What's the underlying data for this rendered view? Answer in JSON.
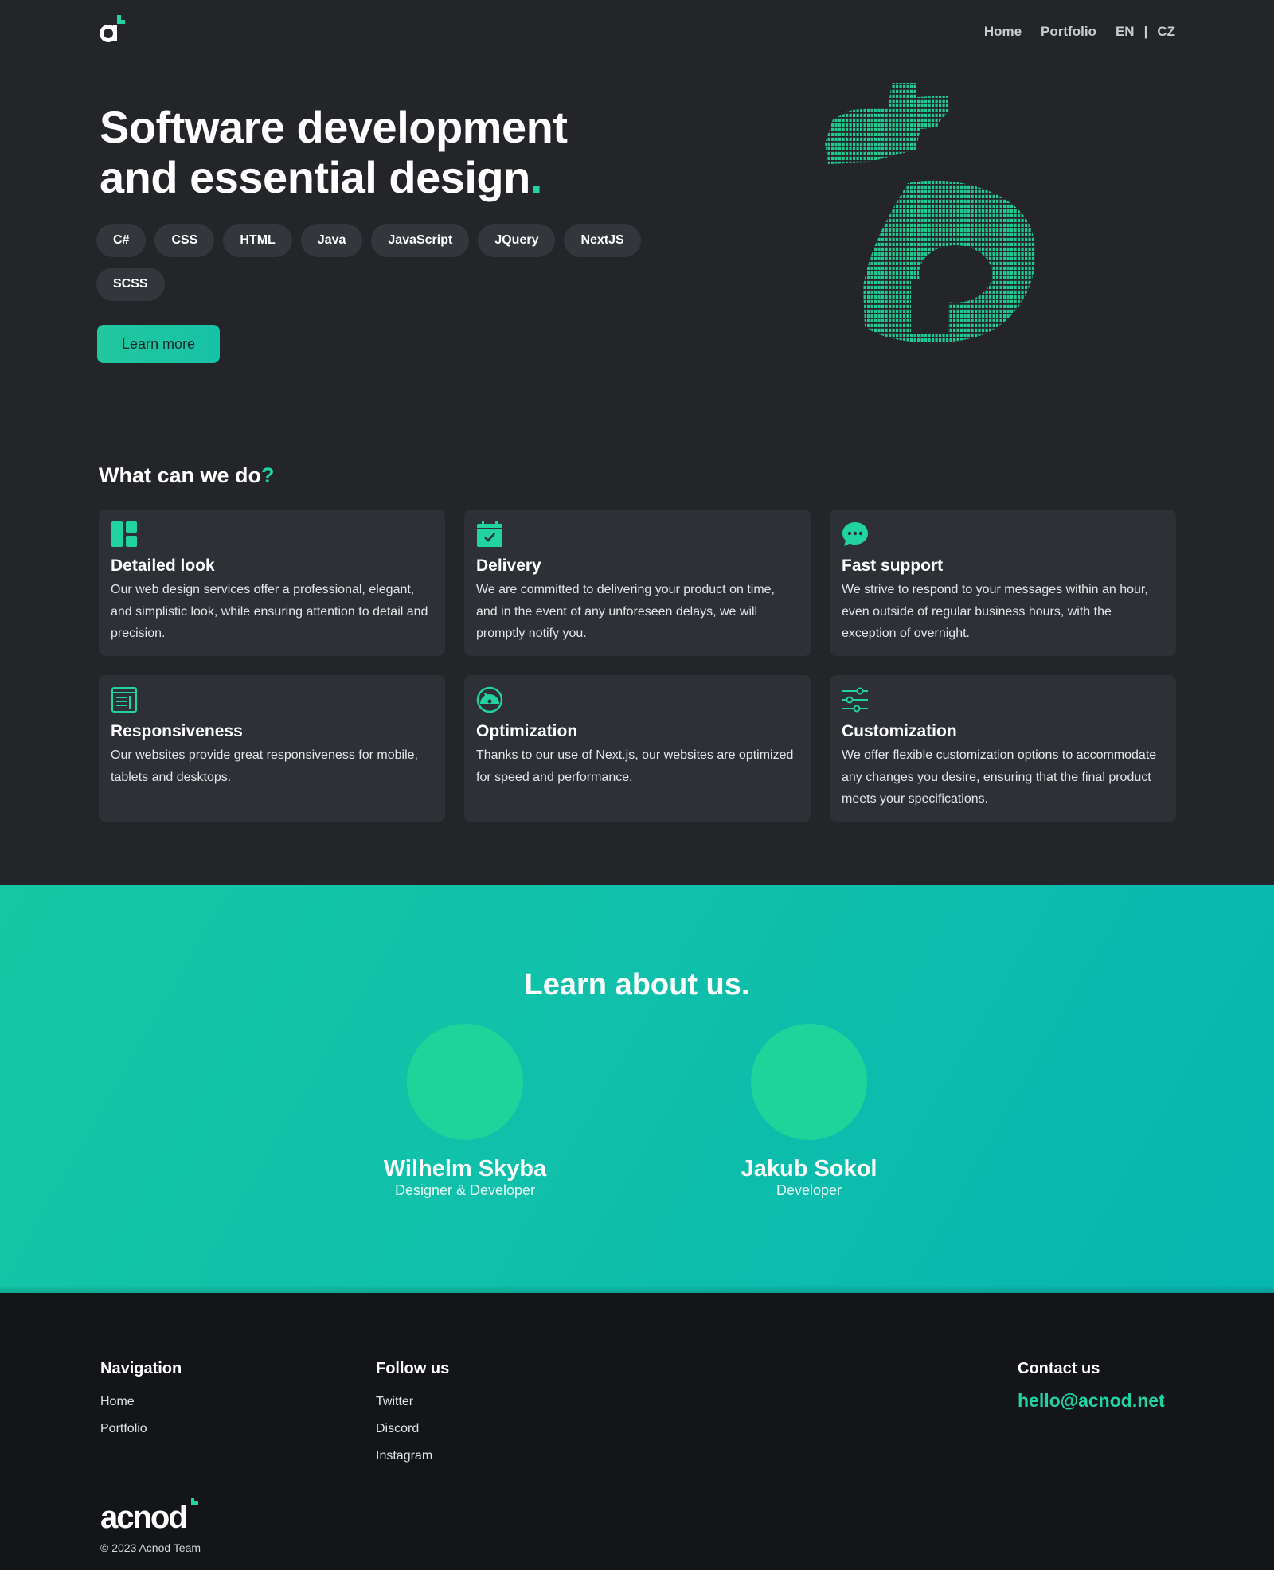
{
  "header": {
    "nav": [
      {
        "label": "Home"
      },
      {
        "label": "Portfolio"
      }
    ],
    "languages": {
      "en": "EN",
      "separator": "|",
      "cz": "CZ"
    }
  },
  "hero": {
    "title_line1": "Software development",
    "title_line2": "and essential design",
    "title_dot": ".",
    "tags": [
      "C#",
      "CSS",
      "HTML",
      "Java",
      "JavaScript",
      "JQuery",
      "NextJS",
      "SCSS"
    ],
    "cta_label": "Learn more"
  },
  "services": {
    "title": "What can we do",
    "title_mark": "?",
    "cards": [
      {
        "icon": "layout-icon",
        "title": "Detailed look",
        "text": "Our web design services offer a professional, elegant, and simplistic look, while ensuring attention to detail and precision."
      },
      {
        "icon": "calendar-check-icon",
        "title": "Delivery",
        "text": "We are committed to delivering your product on time, and in the event of any unforeseen delays, we will promptly notify you."
      },
      {
        "icon": "chat-bubble-icon",
        "title": "Fast support",
        "text": "We strive to respond to your messages within an hour, even outside of regular business hours, with the exception of overnight."
      },
      {
        "icon": "newspaper-icon",
        "title": "Responsiveness",
        "text": "Our websites provide great responsiveness for mobile, tablets and desktops."
      },
      {
        "icon": "speedometer-icon",
        "title": "Optimization",
        "text": "Thanks to our use of Next.js, our websites are optimized for speed and performance."
      },
      {
        "icon": "sliders-icon",
        "title": "Customization",
        "text": "We offer flexible customization options to accommodate any changes you desire, ensuring that the final product meets your specifications."
      }
    ]
  },
  "about": {
    "title": "Learn about us.",
    "members": [
      {
        "name": "Wilhelm Skyba",
        "role": "Designer & Developer"
      },
      {
        "name": "Jakub Sokol",
        "role": "Developer"
      }
    ]
  },
  "footer": {
    "navigation": {
      "title": "Navigation",
      "links": [
        "Home",
        "Portfolio"
      ]
    },
    "follow": {
      "title": "Follow us",
      "links": [
        "Twitter",
        "Discord",
        "Instagram"
      ]
    },
    "contact": {
      "title": "Contact us",
      "email": "hello@acnod.net"
    },
    "logo_text": "acnod",
    "copyright": "© 2023 Acnod Team"
  },
  "colors": {
    "accent": "#20d3a0",
    "background": "#232529",
    "card": "#2d3035",
    "footer": "#131519",
    "about_gradient_start": "#15c7a4",
    "about_gradient_end": "#06b6b0"
  }
}
